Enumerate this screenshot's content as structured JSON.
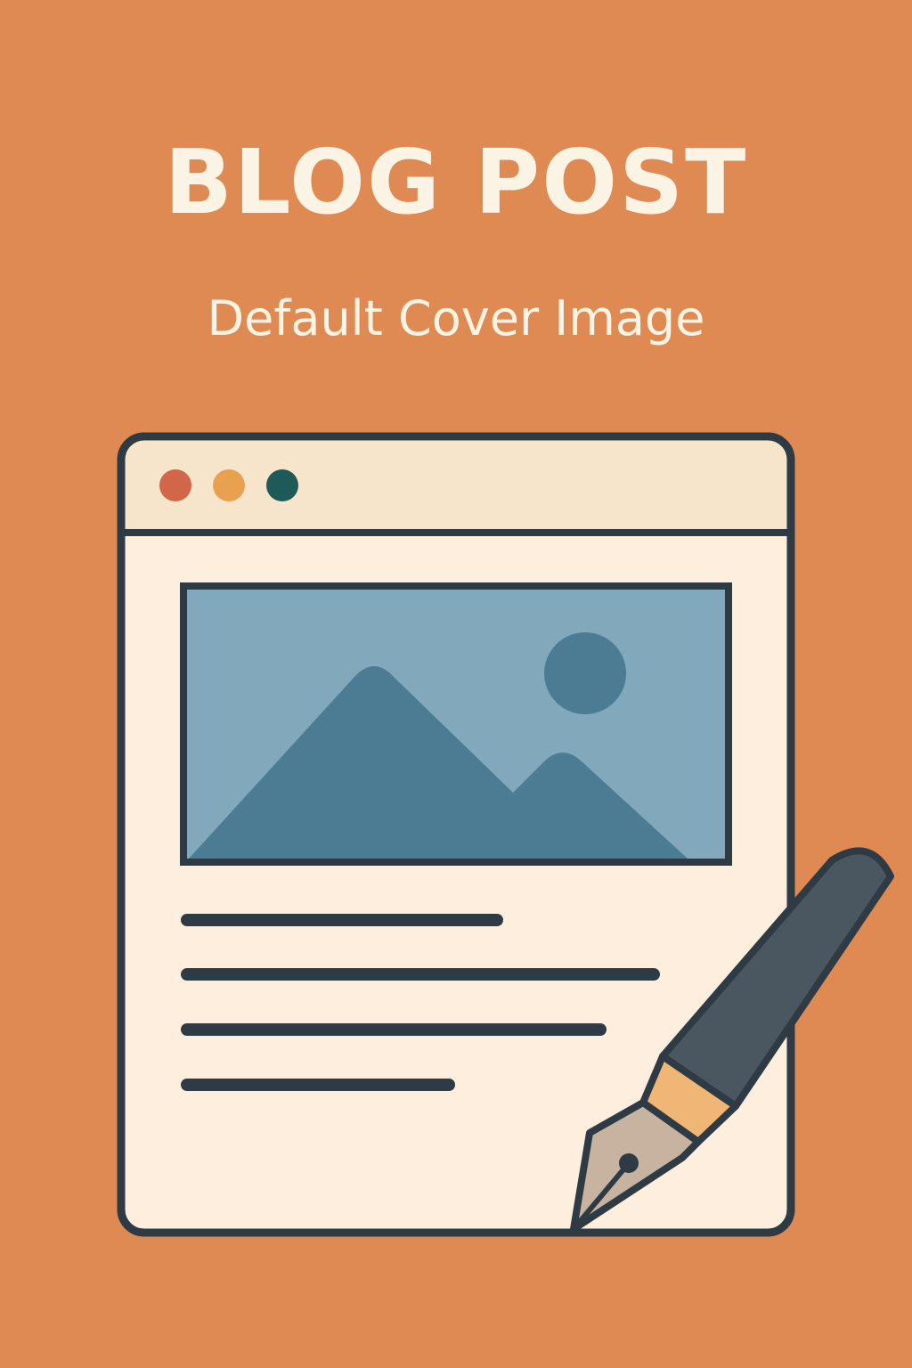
{
  "cover": {
    "title": "BLOG POST",
    "subtitle": "Default Cover Image"
  },
  "illustration": {
    "icons": [
      "browser-window-icon",
      "image-placeholder-icon",
      "fountain-pen-icon"
    ],
    "window_dots": [
      {
        "name": "red",
        "color": "#d26648"
      },
      {
        "name": "yellow",
        "color": "#e8a24f"
      },
      {
        "name": "green",
        "color": "#1e5a57"
      }
    ]
  },
  "colors": {
    "background": "#df8a52",
    "text": "#fbf3e4",
    "window_body": "#fdeedd",
    "window_header": "#f6e4cb",
    "outline": "#2e3b45",
    "sky": "#82a8bc",
    "mountain": "#4b7c94",
    "pen_body": "#4a5761",
    "pen_grip": "#f0b676",
    "nib": "#c8b3a1"
  }
}
